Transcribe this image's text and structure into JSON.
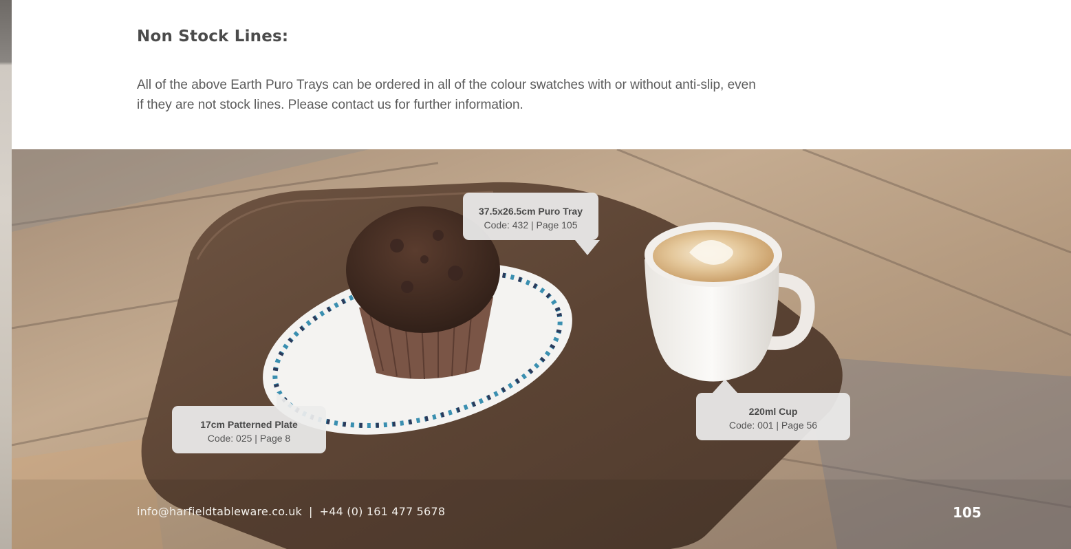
{
  "section": {
    "heading": "Non Stock Lines:",
    "paragraph": "All of the above Earth Puro Trays can be ordered in all of the colour swatches with or without anti-slip, even if they are not stock lines. Please contact us for further information."
  },
  "callouts": {
    "tray": {
      "title": "37.5x26.5cm Puro Tray",
      "code": "Code: 432  |  Page 105"
    },
    "plate": {
      "title": "17cm Patterned Plate",
      "code": "Code: 025  |  Page 8"
    },
    "cup": {
      "title": "220ml Cup",
      "code": "Code: 001  |  Page 56"
    }
  },
  "footer": {
    "email": "info@harfieldtableware.co.uk",
    "separator": "|",
    "phone": "+44 (0) 161 477 5678",
    "page_number": "105"
  },
  "colors": {
    "heading": "#4b4b4b",
    "text": "#5a5a5a",
    "callout_bg": "#ececec",
    "tray": "#5a4333",
    "table_wood": "#b89a7c"
  }
}
